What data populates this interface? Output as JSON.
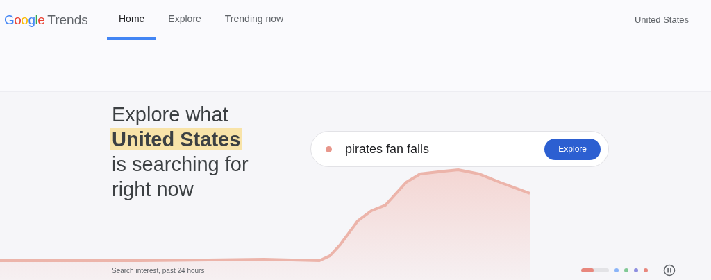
{
  "header": {
    "logo": {
      "brand": "Google",
      "product": "Trends"
    },
    "tabs": [
      {
        "label": "Home",
        "selected": true
      },
      {
        "label": "Explore",
        "selected": false
      },
      {
        "label": "Trending now",
        "selected": false
      }
    ],
    "region": "United States"
  },
  "hero": {
    "heading": {
      "before": "Explore what",
      "highlight": "United States",
      "after": "is searching for right now"
    },
    "search": {
      "value": "pirates fan falls",
      "color": "#e8978c",
      "button": "Explore"
    },
    "caption": "Search interest, past 24 hours",
    "slides": [
      {
        "kind": "progress",
        "color": "#e8877d",
        "level": 0.45
      },
      {
        "kind": "dot",
        "color": "#8ab4f8"
      },
      {
        "kind": "dot",
        "color": "#81c995"
      },
      {
        "kind": "dot",
        "color": "#8e8fe0"
      },
      {
        "kind": "dot",
        "color": "#e8877d"
      }
    ]
  }
}
